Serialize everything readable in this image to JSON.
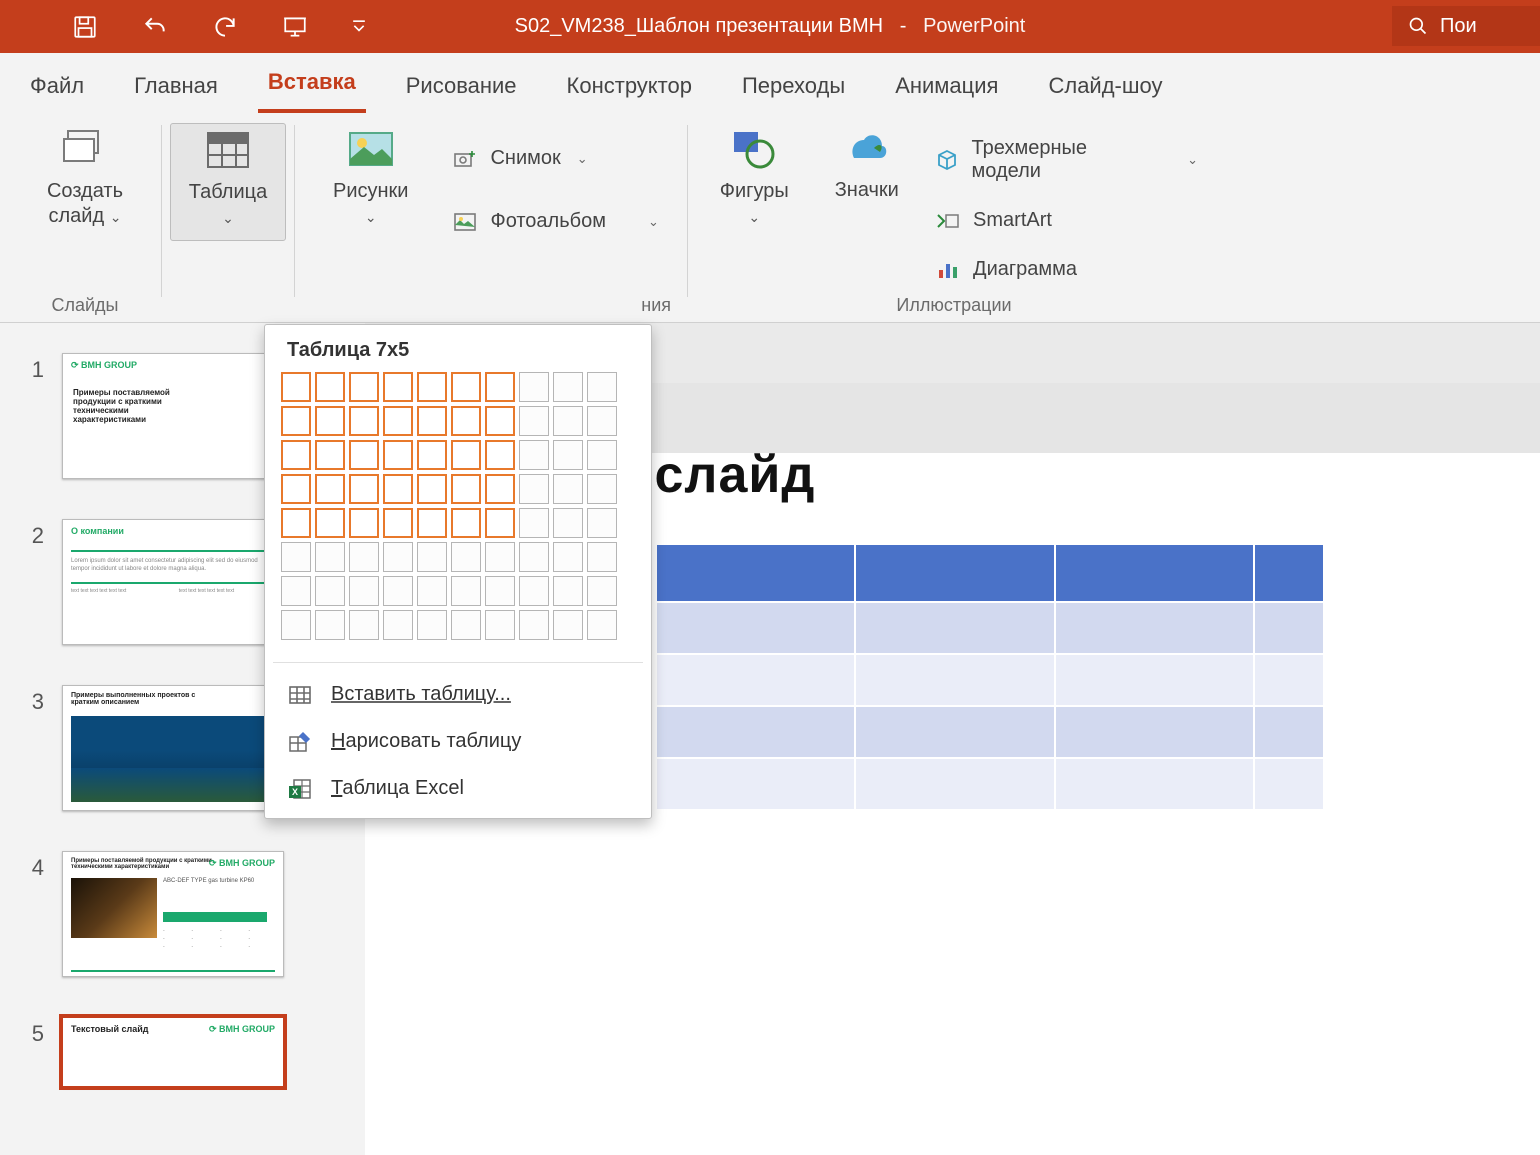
{
  "window": {
    "doc_title": "S02_VM238_Шаблон презентации BMH",
    "app_name": "PowerPoint",
    "search_label": "Пои"
  },
  "tabs": {
    "file": "Файл",
    "home": "Главная",
    "insert": "Вставка",
    "draw": "Рисование",
    "design": "Конструктор",
    "transitions": "Переходы",
    "animations": "Анимация",
    "slideshow": "Слайд-шоу"
  },
  "ribbon": {
    "new_slide_l1": "Создать",
    "new_slide_l2": "слайд",
    "table": "Таблица",
    "pictures": "Рисунки",
    "screenshot": "Снимок",
    "photoalbum": "Фотоальбом",
    "shapes": "Фигуры",
    "icons": "Значки",
    "models3d": "Трехмерные модели",
    "smartart": "SmartArt",
    "chart": "Диаграмма",
    "group_slides": "Слайды",
    "group_images_suffix": "ния",
    "group_illustrations": "Иллюстрации"
  },
  "table_dropdown": {
    "title": "Таблица 7x5",
    "cols_total": 10,
    "rows_total": 8,
    "cols_sel": 7,
    "rows_sel": 5,
    "insert_table": "Вставить таблицу...",
    "draw_table": "Нарисовать таблицу",
    "excel_table": "Таблица Excel"
  },
  "thumbs": {
    "n1": "1",
    "n2": "2",
    "n3": "3",
    "n4": "4",
    "n5": "5",
    "brand": "⟳ BMH GROUP",
    "t1": "Примеры поставляемой продукции с краткими техническими характеристиками",
    "t2": "О компании",
    "t3": "Примеры выполненных проектов с кратким описанием",
    "t4": "Примеры поставляемой продукции с краткими техническими характеристиками",
    "t5": "Текстовый слайд"
  },
  "slide": {
    "title_partial": "екстовый слайд",
    "table_cols": 4,
    "table_body_rows": 4
  },
  "colors": {
    "accent": "#c43e1c",
    "table_header": "#4a72c8",
    "table_row_odd": "#d2d9ef",
    "table_row_even": "#eaedf8",
    "grid_sel_border": "#e8792b"
  }
}
